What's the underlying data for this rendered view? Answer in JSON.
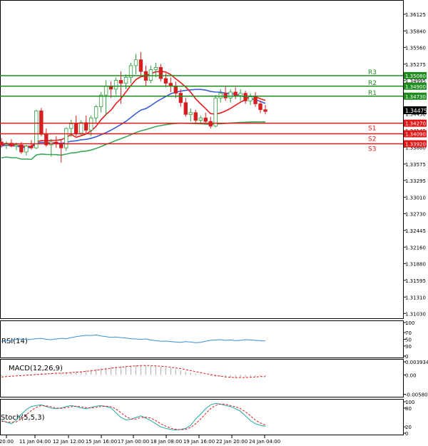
{
  "colors": {
    "up": "#2e9e3e",
    "down": "#d42020",
    "resistance": "#1e8c1e",
    "support": "#e01818",
    "ma_fast": "#e81c1c",
    "ma_mid": "#3a5fd8",
    "ma_slow": "#3aa85a",
    "rsi": "#3a8fd8",
    "macd_hist": "#b8b8b8",
    "macd_signal": "#e01818",
    "stoch_main": "#20a8a8",
    "stoch_signal": "#e01818",
    "current_price_bg": "#000000",
    "frame": "#000000",
    "grid_dot": "#c8c8c8"
  },
  "chart_data": [
    {
      "type": "candlestick",
      "ylim": [
        1.3101,
        1.3627
      ],
      "y_ticks": [
        "1.36125",
        "1.35840",
        "1.35560",
        "1.35275",
        "1.34995",
        "1.34715",
        "1.34430",
        "1.34145",
        "1.33860",
        "1.33575",
        "1.33295",
        "1.33010",
        "1.32730",
        "1.32445",
        "1.32160",
        "1.31880",
        "1.31595",
        "1.31310",
        "1.31030"
      ],
      "x_ticks": [
        "20:00",
        "11 Jan 04:00",
        "12 Jan 12:00",
        "15 Jan 16:00",
        "17 Jan 00:00",
        "18 Jan 08:00",
        "19 Jan 16:00",
        "22 Jan 20:00",
        "24 Jan 04:00"
      ],
      "candles": [
        [
          1.3395,
          1.3402,
          1.3385,
          1.339
        ],
        [
          1.339,
          1.3396,
          1.3383,
          1.3393
        ],
        [
          1.3393,
          1.34,
          1.3386,
          1.3388
        ],
        [
          1.3388,
          1.3394,
          1.3381,
          1.339
        ],
        [
          1.339,
          1.3395,
          1.3375,
          1.3378
        ],
        [
          1.3378,
          1.339,
          1.3372,
          1.3388
        ],
        [
          1.3388,
          1.3398,
          1.3382,
          1.3385
        ],
        [
          1.3385,
          1.345,
          1.3383,
          1.3448
        ],
        [
          1.3448,
          1.3453,
          1.3405,
          1.3408
        ],
        [
          1.3408,
          1.3418,
          1.3387,
          1.339
        ],
        [
          1.339,
          1.34,
          1.337,
          1.3395
        ],
        [
          1.3395,
          1.3405,
          1.3385,
          1.3392
        ],
        [
          1.3392,
          1.34,
          1.336,
          1.3385
        ],
        [
          1.3385,
          1.342,
          1.338,
          1.3418
        ],
        [
          1.3418,
          1.3433,
          1.3404,
          1.3426
        ],
        [
          1.3426,
          1.344,
          1.3405,
          1.341
        ],
        [
          1.341,
          1.3432,
          1.3405,
          1.3428
        ],
        [
          1.3428,
          1.344,
          1.341,
          1.3415
        ],
        [
          1.3415,
          1.344,
          1.3405,
          1.3436
        ],
        [
          1.3436,
          1.3458,
          1.3428,
          1.3455
        ],
        [
          1.3455,
          1.348,
          1.3445,
          1.3475
        ],
        [
          1.3475,
          1.35,
          1.344,
          1.349
        ],
        [
          1.349,
          1.3498,
          1.347,
          1.3485
        ],
        [
          1.3485,
          1.3505,
          1.3475,
          1.35
        ],
        [
          1.35,
          1.3515,
          1.346,
          1.3495
        ],
        [
          1.3495,
          1.351,
          1.3485,
          1.3505
        ],
        [
          1.3505,
          1.353,
          1.3495,
          1.3525
        ],
        [
          1.3525,
          1.3545,
          1.351,
          1.3535
        ],
        [
          1.3535,
          1.3548,
          1.3508,
          1.3515
        ],
        [
          1.3515,
          1.3525,
          1.349,
          1.35
        ],
        [
          1.35,
          1.3525,
          1.3495,
          1.3518
        ],
        [
          1.3518,
          1.353,
          1.3505,
          1.3522
        ],
        [
          1.3522,
          1.3528,
          1.3498,
          1.3503
        ],
        [
          1.3503,
          1.3512,
          1.3488,
          1.3495
        ],
        [
          1.3495,
          1.3505,
          1.348,
          1.349
        ],
        [
          1.349,
          1.3498,
          1.347,
          1.3478
        ],
        [
          1.3478,
          1.3485,
          1.3455,
          1.3462
        ],
        [
          1.3462,
          1.347,
          1.3438,
          1.3442
        ],
        [
          1.3442,
          1.3452,
          1.343,
          1.3445
        ],
        [
          1.3445,
          1.345,
          1.3428,
          1.3432
        ],
        [
          1.3432,
          1.344,
          1.3425,
          1.3436
        ],
        [
          1.3436,
          1.3445,
          1.3428,
          1.343
        ],
        [
          1.343,
          1.3438,
          1.3418,
          1.3422
        ],
        [
          1.3422,
          1.3475,
          1.342,
          1.347
        ],
        [
          1.347,
          1.3485,
          1.3462,
          1.3478
        ],
        [
          1.3478,
          1.349,
          1.3465,
          1.347
        ],
        [
          1.347,
          1.3485,
          1.3462,
          1.348
        ],
        [
          1.348,
          1.3488,
          1.3468,
          1.3474
        ],
        [
          1.3474,
          1.3485,
          1.3465,
          1.3478
        ],
        [
          1.3478,
          1.3482,
          1.346,
          1.3465
        ],
        [
          1.3465,
          1.3478,
          1.3458,
          1.3472
        ],
        [
          1.3472,
          1.348,
          1.3455,
          1.346
        ],
        [
          1.346,
          1.3465,
          1.3444,
          1.345
        ],
        [
          1.345,
          1.3458,
          1.3442,
          1.3447
        ]
      ],
      "indicators": [
        "MA fast (red)",
        "MA mid (blue)",
        "MA slow (green)"
      ],
      "levels": [
        {
          "name": "R3",
          "value": 1.3508,
          "label": "1.35080"
        },
        {
          "name": "R2",
          "value": 1.349,
          "label": "1.34900"
        },
        {
          "name": "R1",
          "value": 1.3473,
          "label": "1.34730"
        },
        {
          "name": "S1",
          "value": 1.3427,
          "label": "1.34270"
        },
        {
          "name": "S2",
          "value": 1.3409,
          "label": "1.34090"
        },
        {
          "name": "S3",
          "value": 1.3392,
          "label": "1.33920"
        }
      ],
      "current_price": "1.34475"
    },
    {
      "type": "line",
      "title": "RSI(14)",
      "ylim": [
        0,
        100
      ],
      "y_ticks": [
        "100",
        "70",
        "50",
        "30",
        "0"
      ],
      "values": [
        44,
        45,
        47,
        50,
        51,
        49,
        50,
        52,
        53,
        50,
        49,
        51,
        53,
        52,
        55,
        58,
        60,
        62,
        61,
        63,
        60,
        58,
        56,
        57,
        55,
        54,
        52,
        51,
        50,
        51,
        48,
        46,
        44,
        45,
        43,
        42,
        41,
        43,
        42,
        40,
        41,
        44,
        47,
        48,
        49,
        47,
        48,
        46,
        47,
        49,
        48,
        47,
        46,
        45
      ]
    },
    {
      "type": "bar",
      "title": "MACD(12,26,9)",
      "ylim": [
        -0.00614,
        0.00394
      ],
      "y_ticks": [
        "0.003934",
        "0.00",
        "-0.005803"
      ],
      "hist": [
        -0.0004,
        -0.0003,
        -0.0002,
        -0.0001,
        0.0,
        0.0001,
        0.0001,
        0.0004,
        0.0005,
        0.0005,
        0.0005,
        0.0006,
        0.0006,
        0.0007,
        0.0009,
        0.001,
        0.0012,
        0.0014,
        0.0016,
        0.0018,
        0.002,
        0.0022,
        0.0024,
        0.0025,
        0.0026,
        0.0027,
        0.0028,
        0.0029,
        0.0029,
        0.0028,
        0.0027,
        0.0026,
        0.0024,
        0.0022,
        0.002,
        0.0017,
        0.0014,
        0.001,
        0.0007,
        0.0004,
        0.0002,
        0.0,
        -0.0003,
        -0.0005,
        -0.0006,
        -0.0007,
        -0.0008,
        -0.0008,
        -0.0008,
        -0.0007,
        -0.0006,
        -0.0005,
        -0.0004,
        -0.0004
      ],
      "signal": [
        -0.0006,
        -0.0005,
        -0.0004,
        -0.0003,
        -0.0002,
        -0.0001,
        0.0,
        0.0001,
        0.0002,
        0.0003,
        0.0004,
        0.0005,
        0.0005,
        0.0006,
        0.0007,
        0.0008,
        0.0009,
        0.0011,
        0.0012,
        0.0014,
        0.0016,
        0.0018,
        0.002,
        0.0022,
        0.0023,
        0.0025,
        0.0026,
        0.0027,
        0.0028,
        0.0028,
        0.0028,
        0.0027,
        0.0026,
        0.0025,
        0.0023,
        0.0021,
        0.0019,
        0.0016,
        0.0013,
        0.001,
        0.0007,
        0.0004,
        0.0001,
        -0.0002,
        -0.0004,
        -0.0006,
        -0.0007,
        -0.0008,
        -0.0008,
        -0.0008,
        -0.0007,
        -0.0006,
        -0.0005,
        -0.0005
      ]
    },
    {
      "type": "line",
      "title": "Stoch(5,5,3)",
      "ylim": [
        0,
        100
      ],
      "y_ticks": [
        "100",
        "80",
        "20",
        "0"
      ],
      "main": [
        40,
        35,
        30,
        42,
        60,
        75,
        85,
        88,
        90,
        85,
        80,
        78,
        80,
        85,
        88,
        85,
        80,
        78,
        82,
        86,
        88,
        85,
        80,
        65,
        50,
        42,
        44,
        50,
        55,
        48,
        40,
        30,
        20,
        15,
        12,
        10,
        12,
        15,
        25,
        45,
        60,
        78,
        90,
        95,
        92,
        88,
        85,
        78,
        70,
        55,
        40,
        30,
        25,
        22
      ],
      "signal": [
        38,
        36,
        34,
        36,
        45,
        58,
        72,
        82,
        88,
        87,
        84,
        80,
        79,
        81,
        84,
        86,
        84,
        81,
        80,
        82,
        85,
        86,
        84,
        77,
        65,
        53,
        45,
        45,
        50,
        51,
        48,
        40,
        30,
        22,
        16,
        12,
        11,
        12,
        18,
        30,
        45,
        62,
        78,
        88,
        93,
        92,
        88,
        84,
        78,
        68,
        55,
        42,
        32,
        26
      ]
    }
  ]
}
